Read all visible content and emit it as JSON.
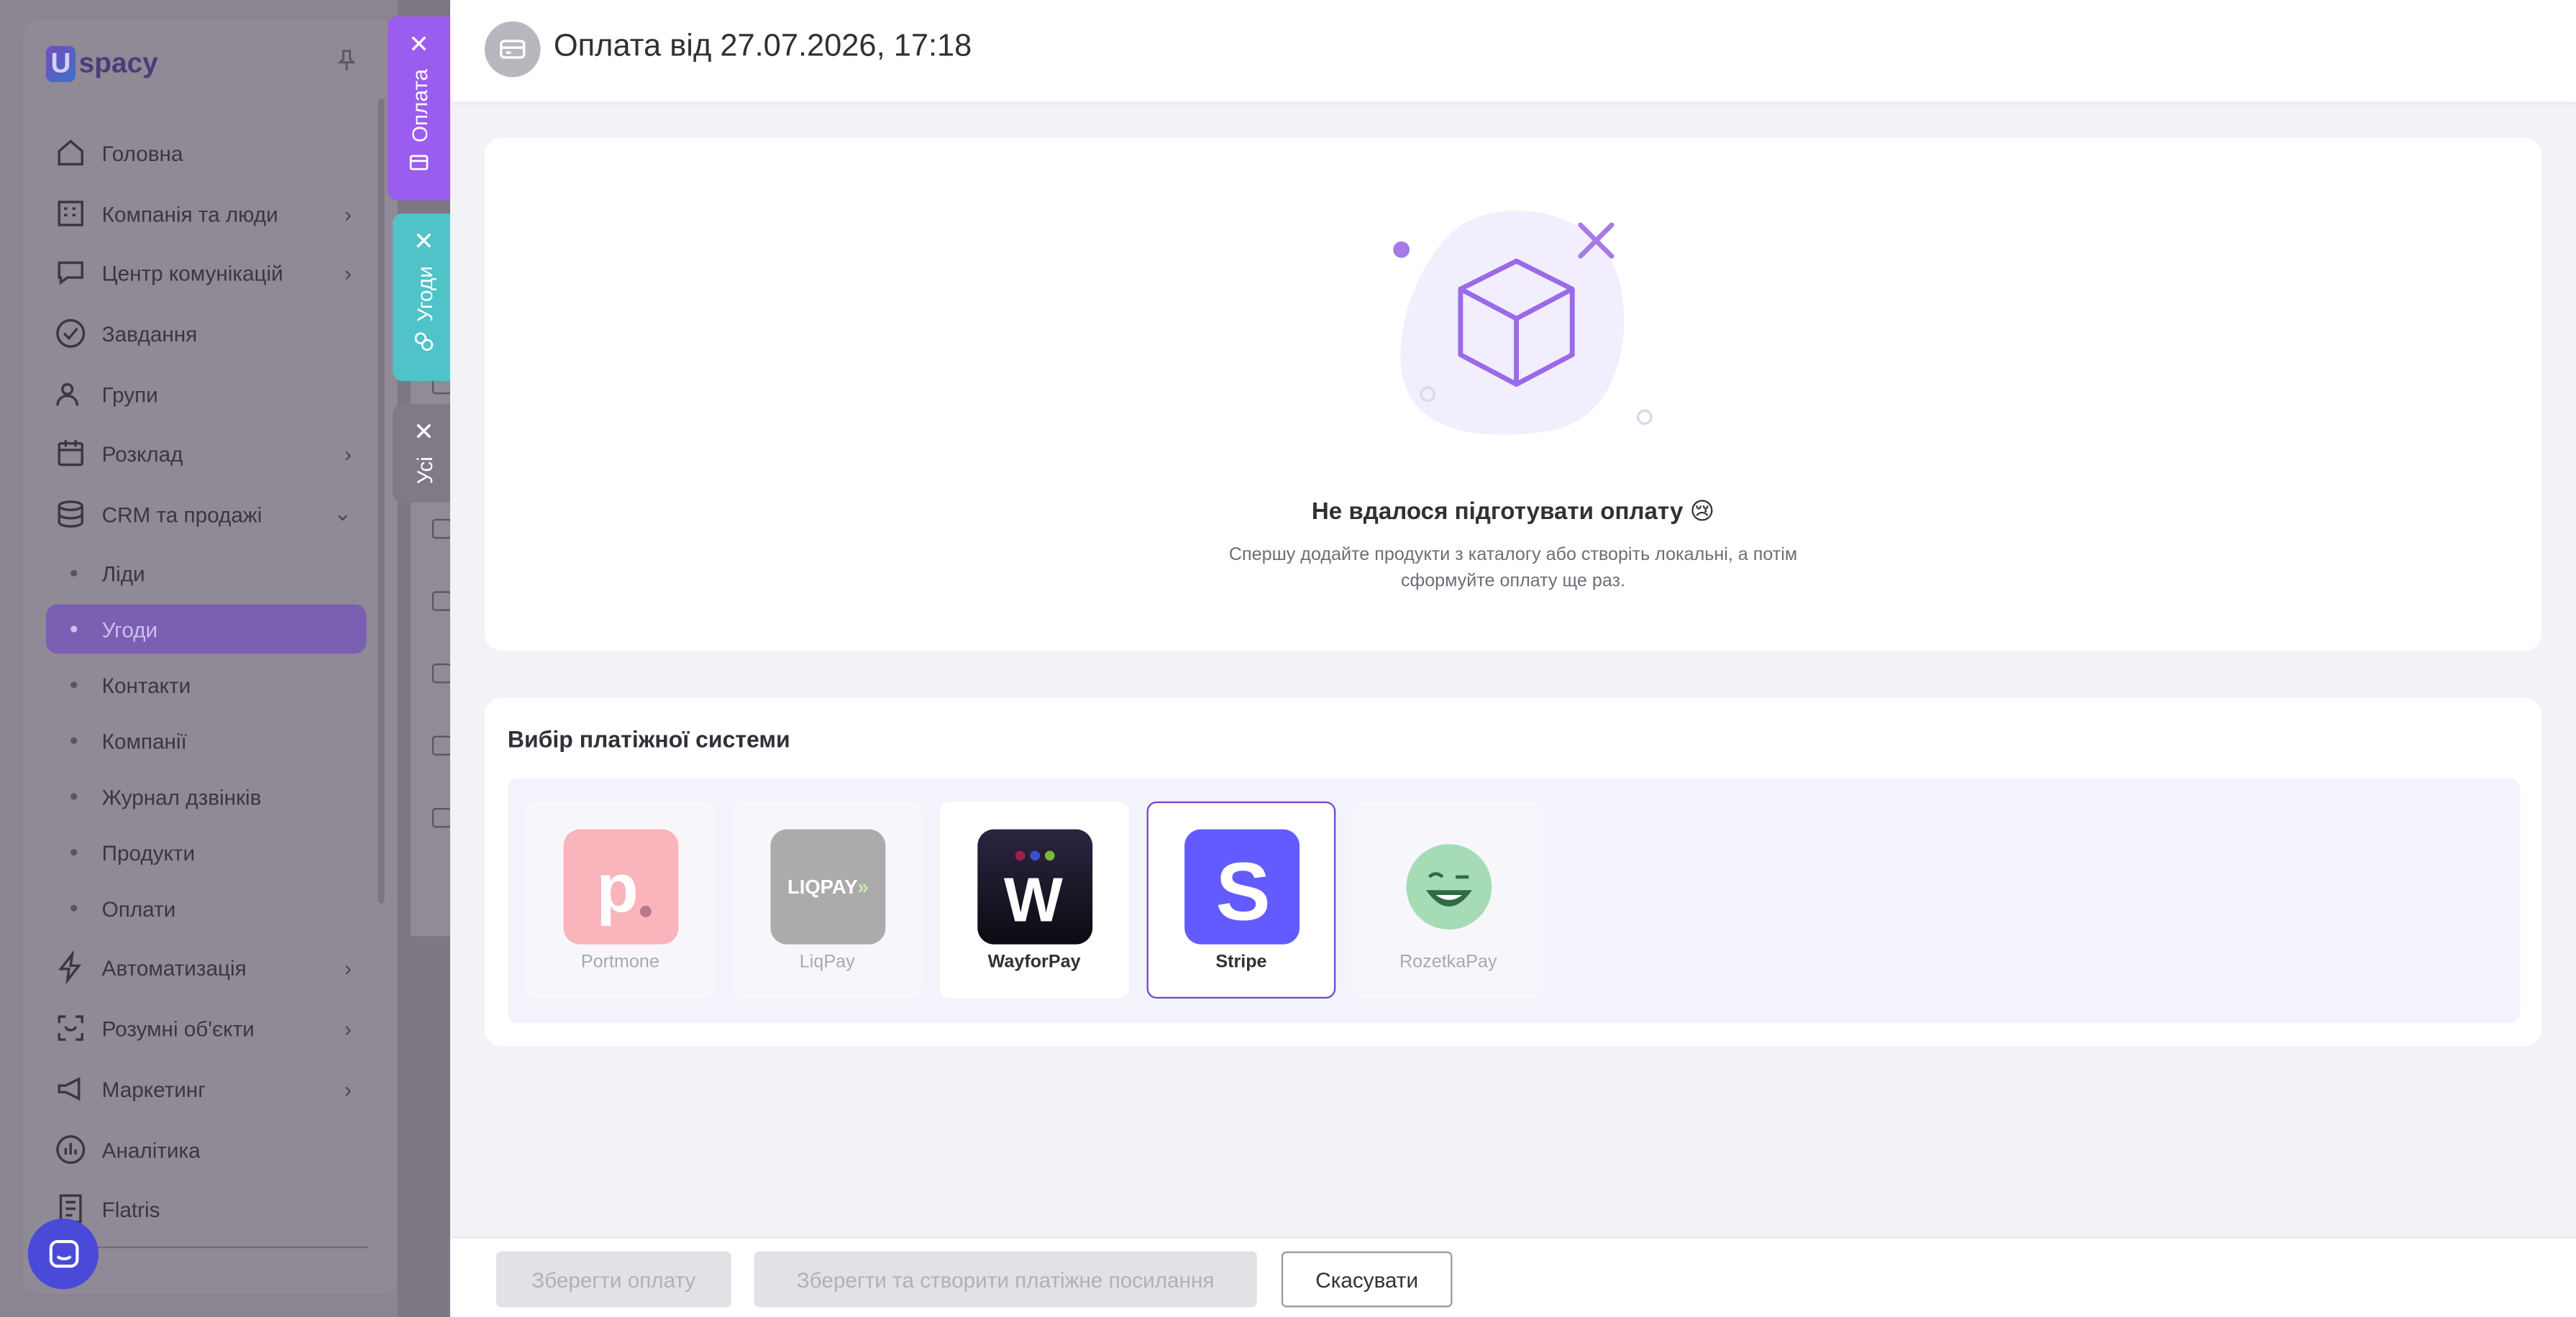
{
  "sidebar": {
    "logo": "spacy",
    "items": [
      {
        "label": "Головна",
        "icon": "home-icon"
      },
      {
        "label": "Компанія та люди",
        "icon": "building-icon"
      },
      {
        "label": "Центр комунікацій",
        "icon": "chat-icon"
      },
      {
        "label": "Завдання",
        "icon": "check-circle-icon"
      },
      {
        "label": "Групи",
        "icon": "users-icon"
      },
      {
        "label": "Розклад",
        "icon": "calendar-icon"
      },
      {
        "label": "CRM та продажі",
        "icon": "database-icon"
      }
    ],
    "crm_sub": [
      "Ліди",
      "Угоди",
      "Контакти",
      "Компанії",
      "Журнал дзвінків",
      "Продукти",
      "Оплати"
    ],
    "items_bottom": [
      {
        "label": "Автоматизація",
        "icon": "lightning-icon"
      },
      {
        "label": "Розумні об'єкти",
        "icon": "scan-icon"
      },
      {
        "label": "Маркетинг",
        "icon": "megaphone-icon"
      },
      {
        "label": "Аналітика",
        "icon": "chart-icon"
      },
      {
        "label": "Flatris",
        "icon": "document-icon"
      }
    ]
  },
  "tabs": {
    "payment": "Оплата",
    "deals": "Угоди",
    "all": "Усі"
  },
  "header": {
    "title": "Оплата від 27.07.2026, 17:18"
  },
  "empty": {
    "title": "Не вдалося підготувати оплату 😢",
    "description": "Спершу додайте продукти з каталогу або створіть локальні, а потім сформуйте оплату ще раз."
  },
  "payment_systems": {
    "title": "Вибір платіжної системи",
    "items": [
      {
        "label": "Portmone",
        "state": "disabled"
      },
      {
        "label": "LiqPay",
        "state": "disabled",
        "logo_text": "LIQPAY"
      },
      {
        "label": "WayforPay",
        "state": "enabled"
      },
      {
        "label": "Stripe",
        "state": "selected"
      },
      {
        "label": "RozetkaPay",
        "state": "disabled"
      }
    ]
  },
  "footer": {
    "save": "Зберегти оплату",
    "save_link": "Зберегти та створити платіжне посилання",
    "cancel": "Скасувати"
  },
  "colors": {
    "accent": "#7446c8",
    "tab_payment": "#9b5cf0",
    "tab_deals": "#4fc3c8",
    "stripe": "#635bff"
  }
}
